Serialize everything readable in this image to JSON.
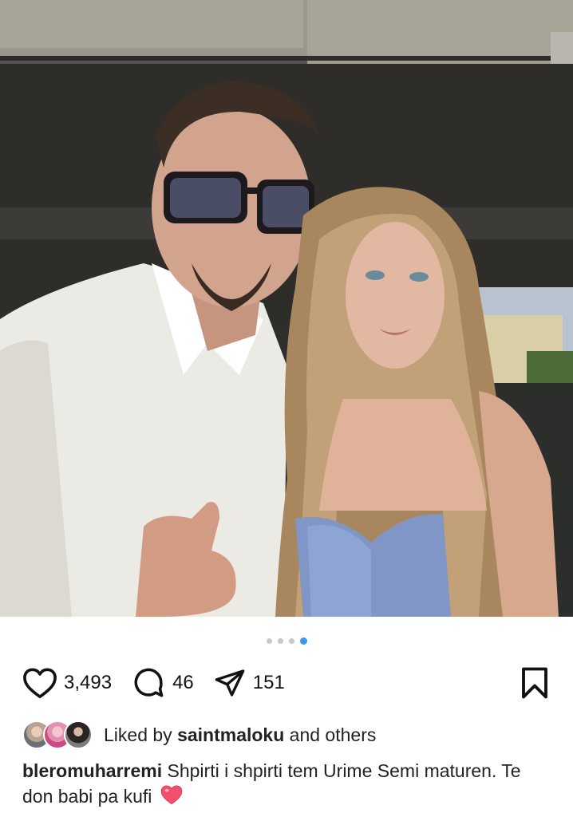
{
  "post": {
    "image_alt": "Photo of a man in a white shirt and sunglasses giving a thumbs up next to a young woman with long wavy hair in a blue dress",
    "carousel": {
      "total": 4,
      "active_index": 4
    },
    "likes_count": "3,493",
    "comments_count": "46",
    "shares_count": "151",
    "liked_by_prefix": "Liked by",
    "liked_by_user": "saintmaloku",
    "liked_by_suffix": "and others",
    "author": "bleromuharremi",
    "caption_text": "Shpirti i shpirti tem Urime Semi maturen. Te don babi pa kufi",
    "caption_emoji": "heart"
  },
  "colors": {
    "active_dot": "#3897f0",
    "inactive_dot": "#c8c8c8",
    "heart_emoji": "#f0506e"
  },
  "icons": [
    "heart-icon",
    "comment-icon",
    "share-icon",
    "bookmark-icon"
  ]
}
